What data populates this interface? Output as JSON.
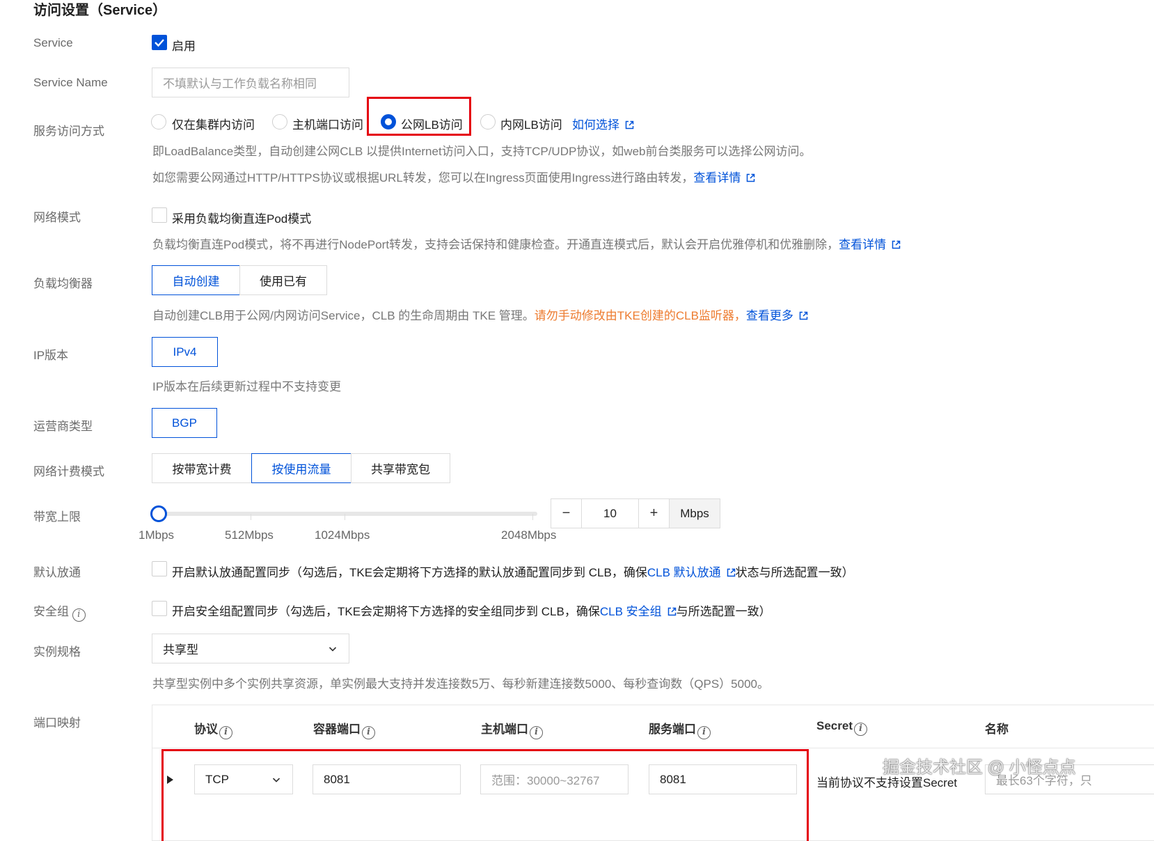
{
  "section_title": "访问设置（Service）",
  "service": {
    "label": "Service",
    "checkbox_label": "启用",
    "checked": true
  },
  "service_name": {
    "label": "Service Name",
    "placeholder": "不填默认与工作负载名称相同"
  },
  "access_mode": {
    "label": "服务访问方式",
    "options": [
      "仅在集群内访问",
      "主机端口访问",
      "公网LB访问",
      "内网LB访问"
    ],
    "selected": "公网LB访问",
    "how_to_choose": "如何选择",
    "hint1": "即LoadBalance类型，自动创建公网CLB 以提供Internet访问入口，支持TCP/UDP协议，如web前台类服务可以选择公网访问。",
    "hint2": "如您需要公网通过HTTP/HTTPS协议或根据URL转发，您可以在Ingress页面使用Ingress进行路由转发，",
    "hint2_link": "查看详情"
  },
  "network_mode": {
    "label": "网络模式",
    "checkbox_label": "采用负载均衡直连Pod模式",
    "hint": "负载均衡直连Pod模式，将不再进行NodePort转发，支持会话保持和健康检查。开通直连模式后，默认会开启优雅停机和优雅删除，",
    "hint_link": "查看详情"
  },
  "load_balancer": {
    "label": "负载均衡器",
    "options": [
      "自动创建",
      "使用已有"
    ],
    "selected": "自动创建",
    "hint": "自动创建CLB用于公网/内网访问Service，CLB 的生命周期由 TKE 管理。",
    "warning": "请勿手动修改由TKE创建的CLB监听器，",
    "hint_link": "查看更多"
  },
  "ip_version": {
    "label": "IP版本",
    "value": "IPv4",
    "hint": "IP版本在后续更新过程中不支持变更"
  },
  "isp_type": {
    "label": "运营商类型",
    "value": "BGP"
  },
  "billing_mode": {
    "label": "网络计费模式",
    "options": [
      "按带宽计费",
      "按使用流量",
      "共享带宽包"
    ],
    "selected": "按使用流量"
  },
  "bandwidth": {
    "label": "带宽上限",
    "ticks": [
      "1Mbps",
      "512Mbps",
      "1024Mbps",
      "2048Mbps"
    ],
    "value": "10",
    "unit": "Mbps",
    "minus": "−",
    "plus": "+",
    "slider_fraction": 0.0
  },
  "default_allow": {
    "label": "默认放通",
    "text_before": "开启默认放通配置同步（勾选后，TKE会定期将下方选择的默认放通配置同步到 CLB，确保",
    "link": "CLB 默认放通",
    "text_after": "状态与所选配置一致）"
  },
  "security_group": {
    "label": "安全组",
    "text_before": "开启安全组配置同步（勾选后，TKE会定期将下方选择的安全组同步到 CLB，确保",
    "link": "CLB 安全组",
    "text_after": "与所选配置一致）"
  },
  "instance_spec": {
    "label": "实例规格",
    "value": "共享型",
    "hint": "共享型实例中多个实例共享资源，单实例最大支持并发连接数5万、每秒新建连接数5000、每秒查询数（QPS）5000。"
  },
  "port_mapping": {
    "label": "端口映射",
    "headers": [
      "协议",
      "容器端口",
      "主机端口",
      "服务端口",
      "Secret",
      "名称"
    ],
    "row": {
      "protocol": "TCP",
      "container_port": "8081",
      "host_port_placeholder": "范围：30000~32767",
      "service_port": "8081",
      "secret_text": "当前协议不支持设置Secret",
      "name_placeholder": "最长63个字符，只"
    }
  },
  "watermark": "掘金技术社区 @ 小怪点点",
  "colors": {
    "primary": "#0052d9",
    "warning": "#ed7b2f",
    "highlight_box": "#e5000f"
  }
}
